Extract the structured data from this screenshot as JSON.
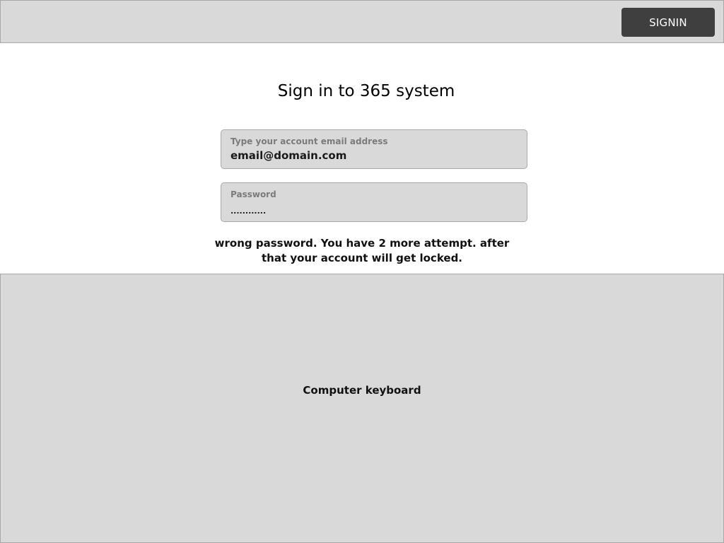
{
  "header": {
    "signin_label": "SIGNIN"
  },
  "main": {
    "title": "Sign in to 365 system",
    "email_field": {
      "label": "Type your account email address",
      "value": "email@domain.com"
    },
    "password_field": {
      "label": "Password",
      "value": "............"
    },
    "error_message": "wrong password. You have 2 more attempt. after that your account will get locked."
  },
  "keyboard": {
    "label": "Computer keyboard"
  },
  "colors": {
    "panel_gray": "#d9d9d9",
    "button_dark": "#3f3f3f",
    "border_gray": "#a8a8a8"
  }
}
